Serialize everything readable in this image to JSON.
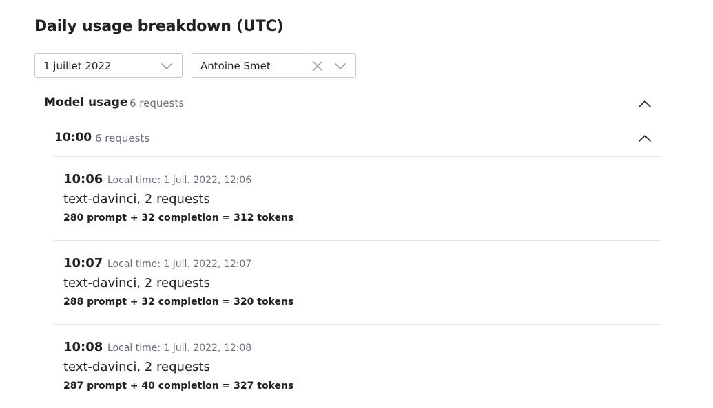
{
  "page": {
    "title": "Daily usage breakdown (UTC)"
  },
  "filters": {
    "date": {
      "value": "1 juillet 2022",
      "icon": "chevron-down-icon"
    },
    "user": {
      "value": "Antoine Smet",
      "clear_icon": "close-icon",
      "icon": "chevron-down-icon"
    }
  },
  "model_usage": {
    "title": "Model usage",
    "count": "6 requests",
    "toggle_icon": "chevron-up-icon"
  },
  "hour_group": {
    "label": "10:00",
    "count": "6 requests",
    "toggle_icon": "chevron-up-icon"
  },
  "entries": [
    {
      "time": "10:06",
      "local": "Local time: 1 juil. 2022, 12:06",
      "model": "text-davinci, 2 requests",
      "tokens": "280 prompt + 32 completion = 312 tokens"
    },
    {
      "time": "10:07",
      "local": "Local time: 1 juil. 2022, 12:07",
      "model": "text-davinci, 2 requests",
      "tokens": "288 prompt + 32 completion = 320 tokens"
    },
    {
      "time": "10:08",
      "local": "Local time: 1 juil. 2022, 12:08",
      "model": "text-davinci, 2 requests",
      "tokens": "287 prompt + 40 completion = 327 tokens"
    }
  ],
  "colors": {
    "text": "#202123",
    "muted": "#6e6e80",
    "border": "#c5c5d2",
    "divider": "#e5e5e5"
  }
}
